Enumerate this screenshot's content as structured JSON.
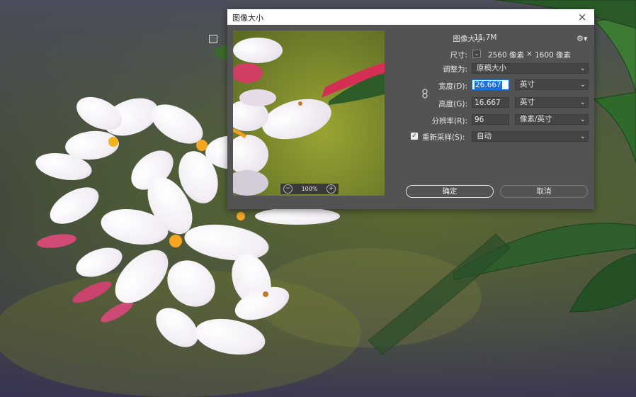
{
  "dialog": {
    "title": "图像大小",
    "close_icon": "×"
  },
  "preview": {
    "zoom_level": "100%",
    "zoom_out_icon": "−",
    "zoom_in_icon": "+"
  },
  "info": {
    "image_size_label": "图像大小:",
    "image_size_value": "11.7M",
    "dimensions_label": "尺寸:",
    "dim_width": "2560 像素",
    "dim_times": "×",
    "dim_height": "1600 像素"
  },
  "form": {
    "fit_to_label": "调整为:",
    "fit_to_value": "原稿大小",
    "width_label": "宽度(D):",
    "width_value": "26.667",
    "width_unit": "英寸",
    "height_label": "高度(G):",
    "height_value": "16.667",
    "height_unit": "英寸",
    "resolution_label": "分辨率(R):",
    "resolution_value": "96",
    "resolution_unit": "像素/英寸",
    "resample_label": "重新采样(S):",
    "resample_checked": true,
    "resample_value": "自动"
  },
  "buttons": {
    "ok": "确定",
    "cancel": "取消"
  },
  "colors": {
    "dialog_bg": "#535353",
    "accent": "#1473e6"
  }
}
